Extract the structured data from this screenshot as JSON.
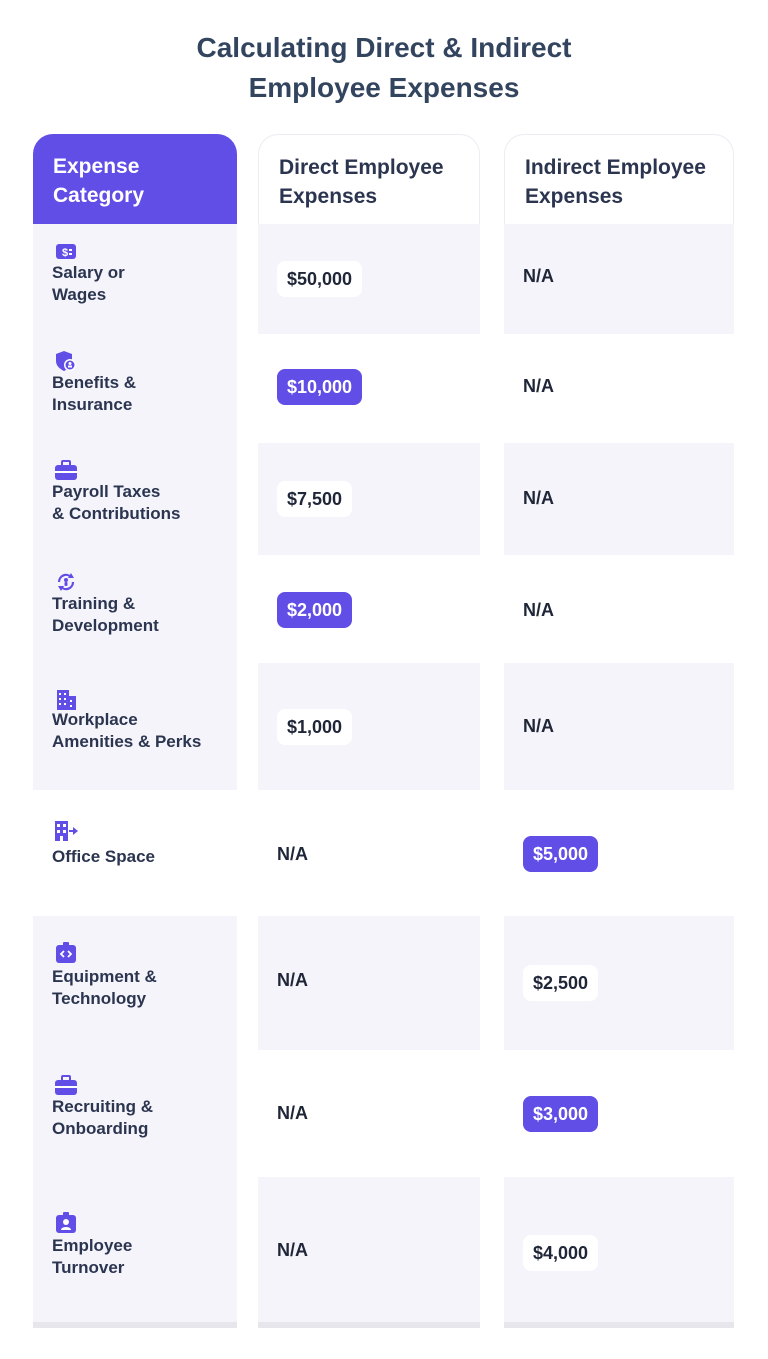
{
  "title": {
    "line1": "Calculating Direct & Indirect",
    "line2": "Employee Expenses"
  },
  "headers": {
    "category": [
      "Expense",
      "Category"
    ],
    "direct": [
      "Direct Employee",
      "Expenses"
    ],
    "indirect": [
      "Indirect Employee",
      "Expenses"
    ]
  },
  "rows": [
    {
      "icon": "dollar-bill-icon",
      "label": [
        "Salary or",
        "Wages"
      ],
      "direct": "$50,000",
      "indirect": "N/A"
    },
    {
      "icon": "shield-user-icon",
      "label": [
        "Benefits &",
        "Insurance"
      ],
      "direct": "$10,000",
      "indirect": "N/A"
    },
    {
      "icon": "briefcase-icon",
      "label": [
        "Payroll Taxes",
        "& Contributions"
      ],
      "direct": "$7,500",
      "indirect": "N/A"
    },
    {
      "icon": "training-cycle-icon",
      "label": [
        "Training &",
        "Development"
      ],
      "direct": "$2,000",
      "indirect": "N/A"
    },
    {
      "icon": "building-icon",
      "label": [
        "Workplace",
        "Amenities & Perks"
      ],
      "direct": "$1,000",
      "indirect": "N/A"
    },
    {
      "icon": "office-arrow-icon",
      "label": [
        "Office Space"
      ],
      "direct": "N/A",
      "indirect": "$5,000"
    },
    {
      "icon": "code-badge-icon",
      "label": [
        "Equipment &",
        "Technology"
      ],
      "direct": "N/A",
      "indirect": "$2,500"
    },
    {
      "icon": "briefcase-icon",
      "label": [
        "Recruiting &",
        "Onboarding"
      ],
      "direct": "N/A",
      "indirect": "$3,000"
    },
    {
      "icon": "id-badge-icon",
      "label": [
        "Employee",
        "Turnover"
      ],
      "direct": "N/A",
      "indirect": "$4,000"
    }
  ],
  "colors": {
    "accent": "#614ee6",
    "title": "#33445e",
    "text": "#2c3550",
    "shaded_cell": "#f4f4fa",
    "bottom_bar": "#e6e6ec"
  }
}
